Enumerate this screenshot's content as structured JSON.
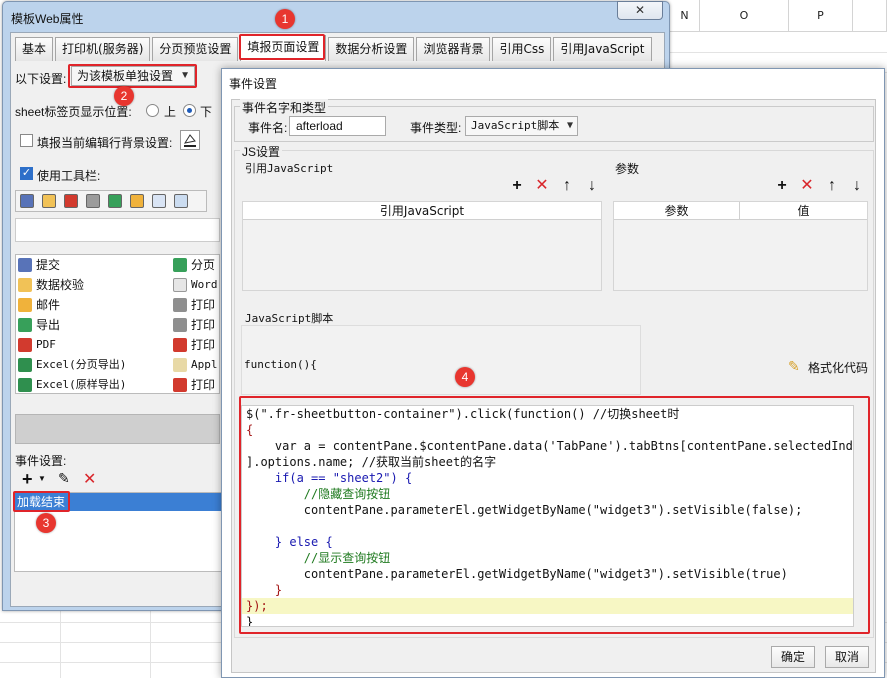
{
  "sheet": {
    "columns": [
      "N",
      "O",
      "P"
    ]
  },
  "win1": {
    "title": "模板Web属性",
    "close": "✕",
    "tabs": [
      "基本",
      "打印机(服务器)",
      "分页预览设置",
      "填报页面设置",
      "数据分析设置",
      "浏览器背景",
      "引用Css",
      "引用JavaScript"
    ],
    "setting_label": "以下设置:",
    "setting_value": "为该模板单独设置",
    "sheet_tab_label": "sheet标签页显示位置:",
    "radio_top": "上",
    "radio_bottom": "下",
    "fill_bg_label": "填报当前编辑行背景设置:",
    "use_toolbar_label": "使用工具栏:",
    "list_left": [
      "提交",
      "数据校验",
      "邮件",
      "导出",
      "PDF",
      "Excel(分页导出)",
      "Excel(原样导出)"
    ],
    "list_right": [
      "分页",
      "Word",
      "打印",
      "打印",
      "打印",
      "Appl",
      "打印"
    ],
    "event_label": "事件设置:",
    "event_item": "加载结束"
  },
  "win2": {
    "title": "事件设置",
    "group_name_type": "事件名字和类型",
    "event_name_label": "事件名:",
    "event_name_value": "afterload",
    "event_type_label": "事件类型:",
    "event_type_value": "JavaScript脚本",
    "js_settings": "JS设置",
    "ref_js_label": "引用JavaScript",
    "params_label": "参数",
    "ref_js_header": "引用JavaScript",
    "param_header": "参数",
    "value_header": "值",
    "script_label": "JavaScript脚本",
    "function_text": "function(){",
    "format_code": "格式化代码",
    "ok": "确定",
    "cancel": "取消"
  },
  "code": [
    "$(\".fr-sheetbutton-container\").click(function() //切换sheet时",
    "{",
    "    var a = contentPane.$contentPane.data('TabPane').tabBtns[contentPane.selectedIndex",
    "].options.name; //获取当前sheet的名字",
    "    if(a == \"sheet2\") {",
    "        //隐藏查询按钮",
    "        contentPane.parameterEl.getWidgetByName(\"widget3\").setVisible(false);",
    "",
    "    } else {",
    "        //显示查询按钮",
    "        contentPane.parameterEl.getWidgetByName(\"widget3\").setVisible(true)",
    "    }",
    "});",
    "}"
  ],
  "badges": [
    "1",
    "2",
    "3",
    "4"
  ],
  "colors": {
    "accent_red": "#e0242a",
    "selection_blue": "#3b7fd4",
    "window_border": "#bcd3ec"
  }
}
